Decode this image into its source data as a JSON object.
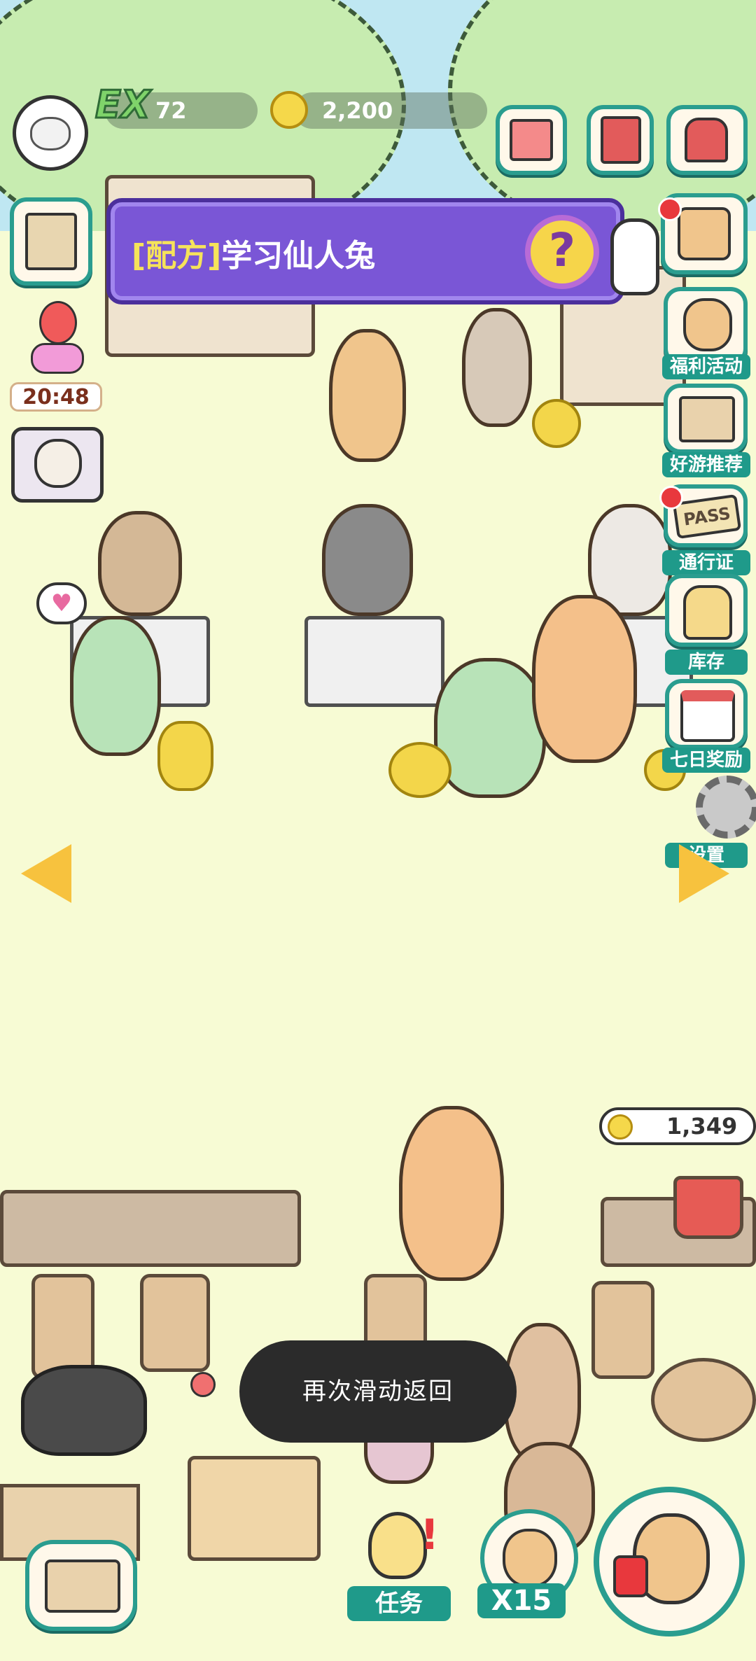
{
  "hud": {
    "ex_label": "EX",
    "ex_value": "72",
    "coins": "2,200"
  },
  "quest": {
    "tag": "[配方]",
    "text": "学习仙人兔",
    "help": "?"
  },
  "timer": "20:48",
  "side_menu": [
    {
      "label": "福利活动",
      "icon": "gift-cat-icon"
    },
    {
      "label": "好游推荐",
      "icon": "game-box-icon"
    },
    {
      "label": "通行证",
      "icon": "pass-ticket-icon"
    },
    {
      "label": "库存",
      "icon": "backpack-icon"
    },
    {
      "label": "七日奖励",
      "icon": "calendar-icon"
    },
    {
      "label": "设置",
      "icon": "gear-icon"
    }
  ],
  "pass_text": "PASS",
  "shop_counter": "1,349",
  "toast": "再次滑动返回",
  "bottom": {
    "task_label": "任务",
    "multiplier": "X15"
  },
  "colors": {
    "accent": "#1f9a8a",
    "quest_bg": "#7a56d6",
    "coin": "#f3d64a",
    "ground": "#f7fbd4"
  }
}
